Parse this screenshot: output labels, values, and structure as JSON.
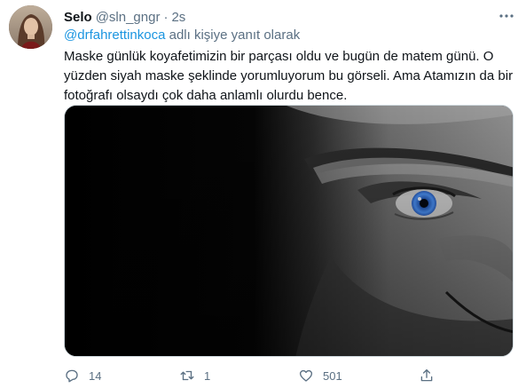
{
  "tweet": {
    "display_name": "Selo",
    "handle": "@sln_gngr",
    "separator": "·",
    "time": "2s",
    "reply": {
      "mention": "@drfahrettinkoca",
      "suffix": " adlı kişiye yanıt olarak"
    },
    "text": "Maske günlük koyafetimizin bir parçası oldu ve bugün de matem günü. O yüzden siyah maske şeklinde yorumluyorum bu görseli. Ama Atamızın da bir fotoğrafı olsaydı çok daha anlamlı olurdu bence.",
    "actions": {
      "replies": "14",
      "retweets": "1",
      "likes": "501"
    }
  },
  "icons": {
    "more": "more-dots-icon",
    "reply": "reply-bubble-icon",
    "retweet": "retweet-icon",
    "like": "heart-icon",
    "share": "share-icon"
  },
  "colors": {
    "accent": "#1b95e0",
    "secondary_text": "#5b7083",
    "primary_text": "#0f1419",
    "eye": "#3d7de0"
  }
}
